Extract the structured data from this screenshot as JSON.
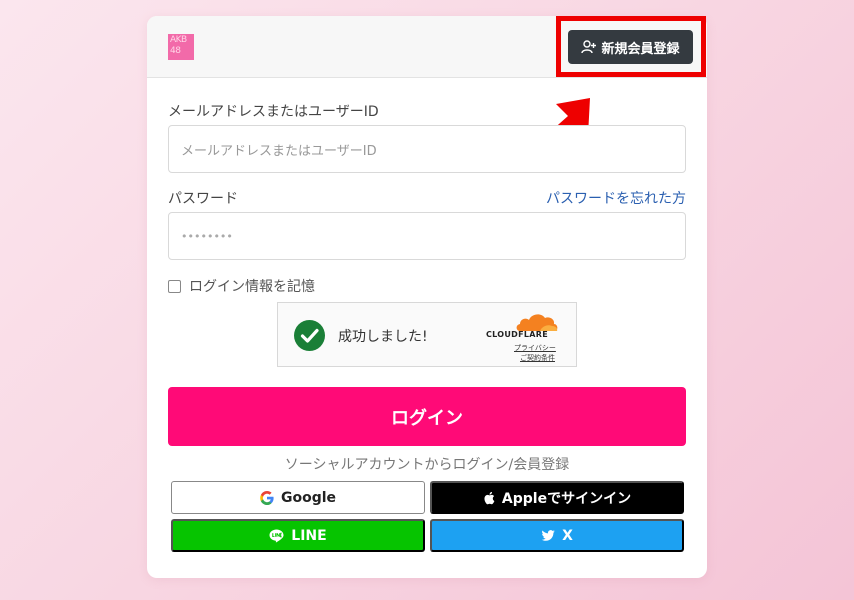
{
  "header": {
    "logo_lines": [
      "AKB",
      "48"
    ],
    "signup_label": "新規会員登録"
  },
  "form": {
    "email_label": "メールアドレスまたはユーザーID",
    "email_placeholder": "メールアドレスまたはユーザーID",
    "password_label": "パスワード",
    "forgot_label": "パスワードを忘れた方",
    "password_value": "••••••••",
    "remember_label": "ログイン情報を記憶"
  },
  "captcha": {
    "status": "成功しました!",
    "brand": "CLOUDFLARE",
    "privacy": "プライバシー",
    "terms": "ご契約条件"
  },
  "login_label": "ログイン",
  "social": {
    "heading": "ソーシャルアカウントからログイン/会員登録",
    "google": "Google",
    "apple": "Appleでサインイン",
    "line": "LINE",
    "x": "X"
  },
  "colors": {
    "accent": "#ff0a77",
    "highlight": "#ee0000",
    "signup_bg": "#343a40",
    "line_green": "#06c400",
    "x_blue": "#1da1f2"
  },
  "icons": [
    "user-plus-icon",
    "check-circle-icon",
    "cloudflare-icon",
    "google-icon",
    "apple-icon",
    "line-icon",
    "twitter-icon",
    "arrow-icon"
  ]
}
